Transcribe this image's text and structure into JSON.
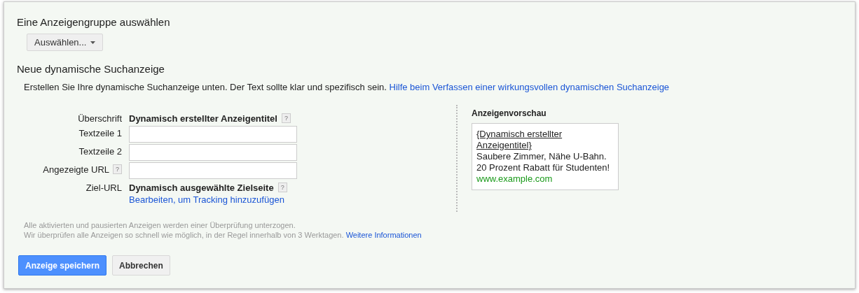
{
  "adgroup": {
    "title": "Eine Anzeigengruppe auswählen",
    "dropdown": "Auswählen..."
  },
  "ad": {
    "title": "Neue dynamische Suchanzeige",
    "intro": "Erstellen Sie Ihre dynamische Suchanzeige unten. Der Text sollte klar und spezifisch sein.",
    "intro_link": "Hilfe beim Verfassen einer wirkungsvollen dynamischen Suchanzeige"
  },
  "fields": [
    {
      "kind": "static",
      "label": "Überschrift",
      "value": "Dynamisch erstellter Anzeigentitel",
      "help": "?"
    },
    {
      "kind": "input",
      "label": "Textzeile 1"
    },
    {
      "kind": "input",
      "label": "Textzeile 2"
    },
    {
      "kind": "input",
      "label": "Angezeigte URL",
      "label_help": "?"
    },
    {
      "kind": "static",
      "label": "Ziel-URL",
      "value": "Dynamisch ausgewählte Zielseite",
      "help": "?",
      "link": "Bearbeiten, um Tracking hinzuzufügen"
    }
  ],
  "preview": {
    "title": "Anzeigenvorschau",
    "headline": "{Dynamisch erstellter Anzeigentitel}",
    "lines": [
      "Saubere Zimmer, Nähe U-Bahn.",
      "20 Prozent Rabatt für Studenten!"
    ],
    "url": "www.example.com"
  },
  "notes": {
    "line_1": "Alle aktivierten und pausierten Anzeigen werden einer Überprüfung unterzogen.",
    "line_2": "Wir überprüfen alle Anzeigen so schnell wie möglich, in der Regel innerhalb von 3 Werktagen.",
    "link": "Weitere Informationen"
  },
  "buttons": [
    {
      "kind": "primary",
      "label": "Anzeige speichern"
    },
    {
      "kind": "secondary",
      "label": "Abbrechen"
    }
  ]
}
